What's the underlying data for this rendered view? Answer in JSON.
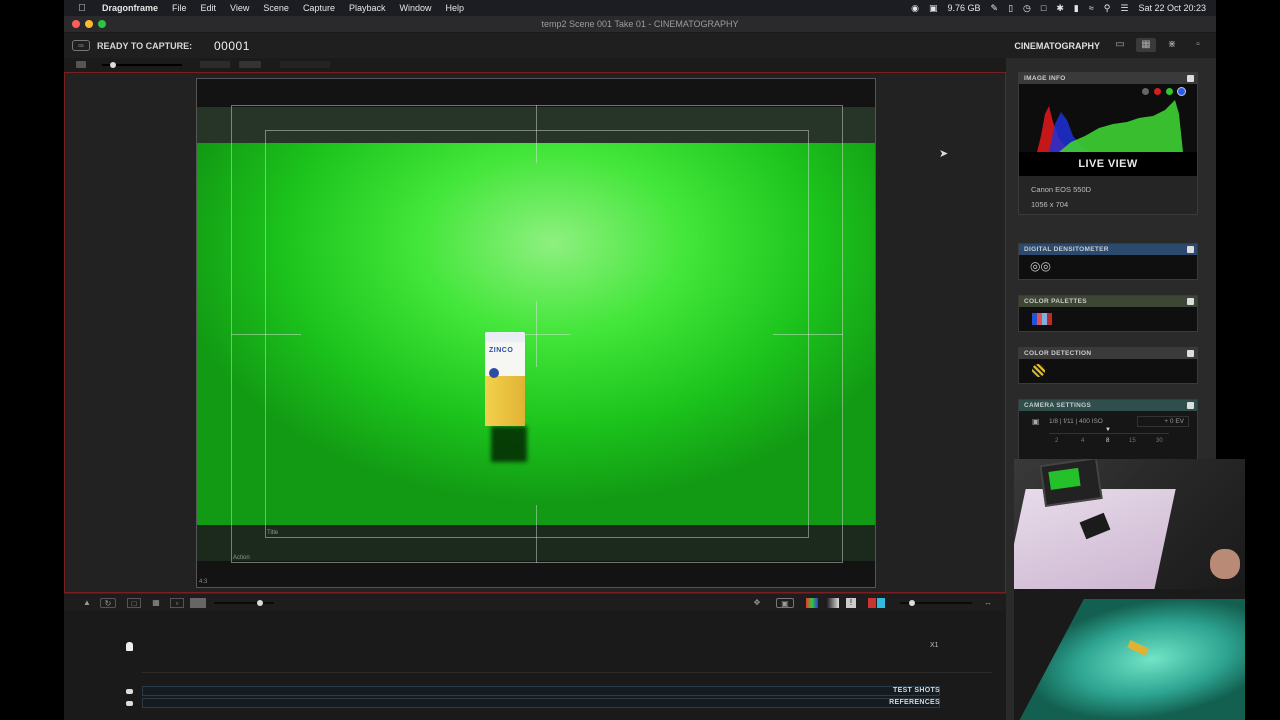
{
  "menubar": {
    "app_name": "Dragonframe",
    "items": [
      "File",
      "Edit",
      "View",
      "Scene",
      "Capture",
      "Playback",
      "Window",
      "Help"
    ],
    "memory": "9.76 GB",
    "datetime": "Sat 22 Oct  20:23"
  },
  "window": {
    "title": "temp2  Scene 001  Take 01 - CINEMATOGRAPHY"
  },
  "toolbar": {
    "ready_label": "READY TO CAPTURE:",
    "frame_number": "00001",
    "workspace": "CINEMATOGRAPHY"
  },
  "viewer": {
    "guide_action_label": "Action",
    "guide_title_label": "Title",
    "aspect_label": "4:3",
    "box_brand": "ZINCO"
  },
  "timeline": {
    "zoom_label": "X1",
    "tracks": [
      {
        "label": "TEST SHOTS"
      },
      {
        "label": "REFERENCES"
      }
    ]
  },
  "right_panel": {
    "image_info": {
      "header": "IMAGE INFO",
      "mode": "LIVE VIEW",
      "camera": "Canon EOS 550D",
      "resolution": "1056 x 704"
    },
    "densitometer": {
      "header": "DIGITAL DENSITOMETER"
    },
    "palettes": {
      "header": "COLOR PALETTES"
    },
    "detection": {
      "header": "COLOR DETECTION"
    },
    "camera_settings": {
      "header": "CAMERA SETTINGS",
      "exposure": "1/8  |  f/11  |  400 ISO",
      "ev": "+ 0 EV",
      "scale": [
        "2",
        "4",
        "8",
        "15",
        "30"
      ]
    }
  },
  "colors": {
    "accent_red": "#7a1f1f",
    "chroma_green": "#43e63a",
    "densitometer_header": "#2b4a6e",
    "palettes_header": "#3d4534",
    "camera_settings_header": "#2e4f4c"
  }
}
